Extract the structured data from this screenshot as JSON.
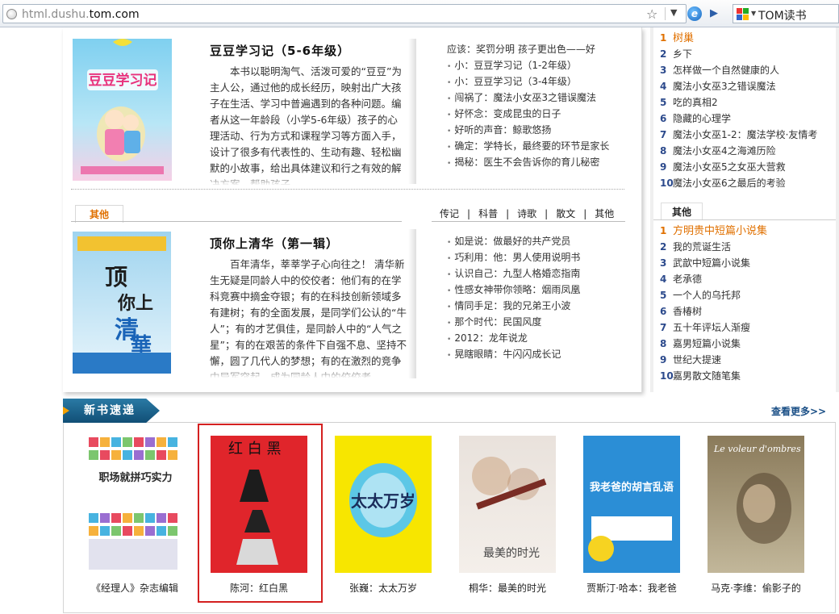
{
  "browser": {
    "url_prefix": "html.dushu.",
    "url_domain": "tom.com",
    "url_suffix": "",
    "search_label": "TOM读书",
    "go_glyph": "▶",
    "star_glyph": "☆",
    "dropdown_glyph": "▼",
    "ie_glyph": "e"
  },
  "book1": {
    "title": "豆豆学习记（5-6年级）",
    "description": "本书以聪明淘气、活泼可爱的“豆豆”为主人公，通过他的成长经历，映射出广大孩子在生活、学习中普遍遇到的各种问题。编者从这一年龄段（小学5-6年级）孩子的心理活动、行为方式和课程学习等方面入手，设计了很多有代表性的、生动有趣、轻松幽默的小故事，给出具体建议和行之有效的解决方案，帮助孩子",
    "cover_title": "豆豆学习记"
  },
  "list1": [
    "应该：奖罚分明 孩子更出色——好",
    "小：豆豆学习记（1-2年级）",
    "小：豆豆学习记（3-4年级）",
    "闯祸了：魔法小女巫3之错误魔法",
    "好怀念：变成昆虫的日子",
    "好听的声音：鲸歌悠扬",
    "确定：学特长，最终要的环节是家长",
    "揭秘：医生不会告诉你的育儿秘密"
  ],
  "other_tab": "其他",
  "categories": [
    "传记",
    "|",
    "科普",
    "|",
    "诗歌",
    "|",
    "散文",
    "|",
    "其他"
  ],
  "book2": {
    "title": "顶你上清华（第一辑）",
    "description": "百年清华，莘莘学子心向往之！ 清华新生无疑是同龄人中的佼佼者：他们有的在学科竞赛中摘金夺银；有的在科技创新领域多有建树；有的全面发展，是同学们公认的“牛人”；有的才艺俱佳，是同龄人中的“人气之星”；有的在艰苦的条件下自强不息、坚持不懈，圆了几代人的梦想；有的在激烈的竞争中异军突起，成为同龄人中的佼佼者",
    "cover_title": "顶你上清华"
  },
  "list2": [
    "如是说：做最好的共产党员",
    "巧利用：他：男人使用说明书",
    "认识自己：九型人格婚恋指南",
    "性感女神带你领略：烟雨凤凰",
    "情同手足：我的兄弟王小波",
    "那个时代：民国风度",
    "2012：龙年说龙",
    "晃瞎眼睛：牛闪闪成长记"
  ],
  "rank1": [
    {
      "n": "1",
      "t": "树巢"
    },
    {
      "n": "2",
      "t": "乡下"
    },
    {
      "n": "3",
      "t": "怎样做一个自然健康的人"
    },
    {
      "n": "4",
      "t": "魔法小女巫3之错误魔法"
    },
    {
      "n": "5",
      "t": "吃的真相2"
    },
    {
      "n": "6",
      "t": "隐藏的心理学"
    },
    {
      "n": "7",
      "t": "魔法小女巫1-2：魔法学校·友情考"
    },
    {
      "n": "8",
      "t": "魔法小女巫4之海滩历险"
    },
    {
      "n": "9",
      "t": "魔法小女巫5之女巫大营救"
    },
    {
      "n": "10",
      "t": "魔法小女巫6之最后的考验"
    }
  ],
  "rank_tab": "其他",
  "rank2": [
    {
      "n": "1",
      "t": "方明贵中短篇小说集"
    },
    {
      "n": "2",
      "t": "我的荒诞生活"
    },
    {
      "n": "3",
      "t": "武歆中短篇小说集"
    },
    {
      "n": "4",
      "t": "老承德"
    },
    {
      "n": "5",
      "t": "一个人的乌托邦"
    },
    {
      "n": "6",
      "t": "香椿树"
    },
    {
      "n": "7",
      "t": "五十年评坛人渐瘦"
    },
    {
      "n": "8",
      "t": "嘉男短篇小说集"
    },
    {
      "n": "9",
      "t": "世纪大提速"
    },
    {
      "n": "10",
      "t": "嘉男散文随笔集"
    }
  ],
  "newbooks": {
    "label": "新书速递",
    "more": "查看更多>>",
    "items": [
      {
        "caption": "《经理人》杂志编辑",
        "cover": "职场就拼巧实力"
      },
      {
        "caption": "陈河：红白黑",
        "cover": "红 白 黑"
      },
      {
        "caption": "张巍：太太万岁",
        "cover": "太太万岁"
      },
      {
        "caption": "桐华：最美的时光",
        "cover": "最美的时光"
      },
      {
        "caption": "贾斯汀·哈本：我老爸",
        "cover": "我老爸的胡言乱语"
      },
      {
        "caption": "马克·李维：偷影子的",
        "cover": "Le voleur d'ombres"
      }
    ]
  },
  "colors": {
    "accent": "#e07000",
    "link": "#2c4a8c",
    "highlight": "#d42020"
  }
}
